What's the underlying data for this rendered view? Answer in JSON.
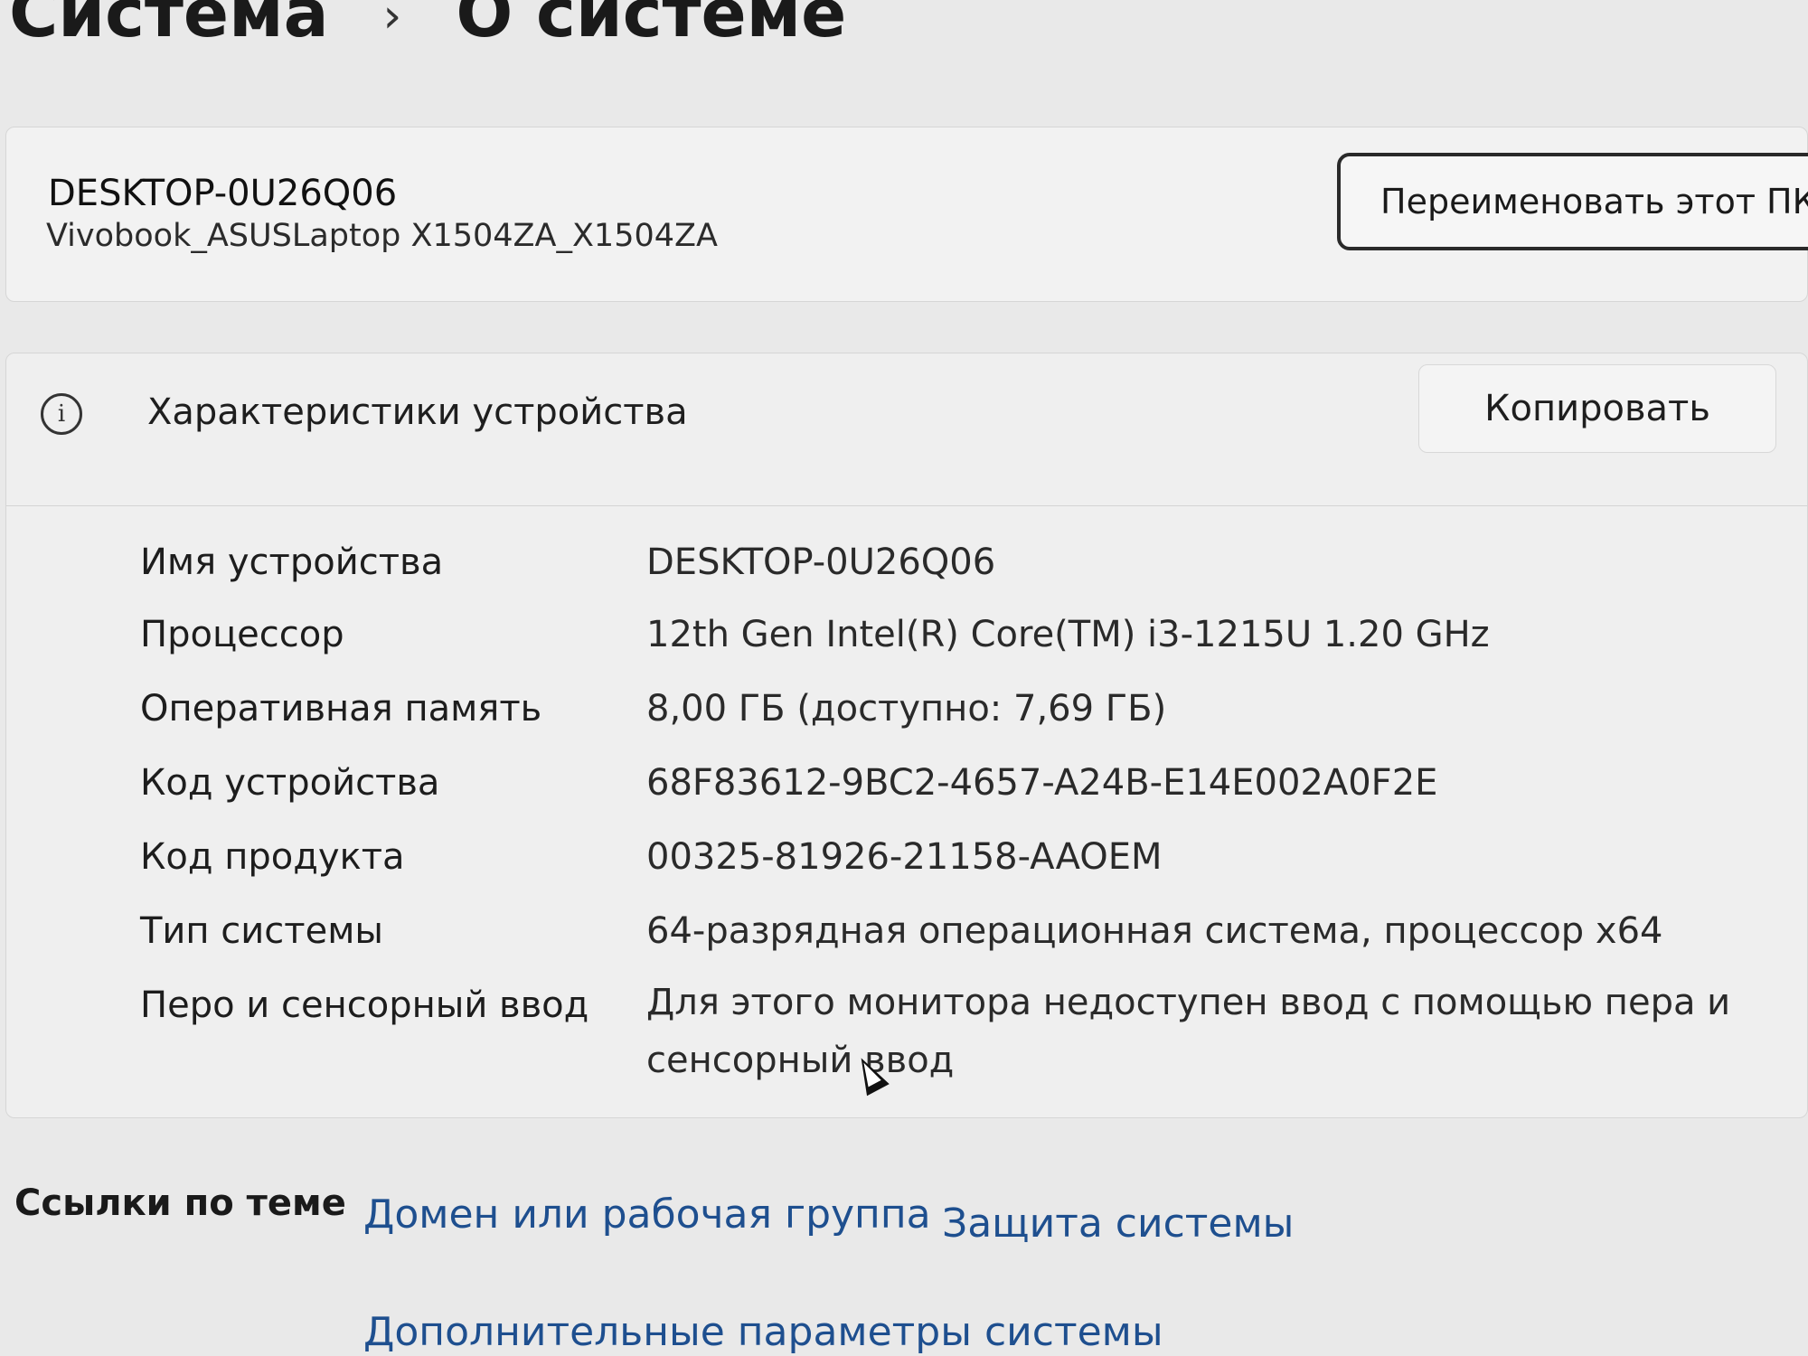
{
  "breadcrumb": {
    "root": "Система",
    "separator": "›",
    "current": "О системе"
  },
  "pc": {
    "name": "DESKTOP-0U26Q06",
    "model": "Vivobook_ASUSLaptop X1504ZA_X1504ZA",
    "rename_label": "Переименовать этот ПК"
  },
  "specs": {
    "icon": "info-icon",
    "title": "Характеристики устройства",
    "copy_label": "Копировать",
    "rows": [
      {
        "label": "Имя устройства",
        "value": "DESKTOP-0U26Q06"
      },
      {
        "label": "Процессор",
        "value": "12th Gen Intel(R) Core(TM) i3-1215U   1.20 GHz"
      },
      {
        "label": "Оперативная память",
        "value": "8,00 ГБ (доступно: 7,69 ГБ)"
      },
      {
        "label": "Код устройства",
        "value": "68F83612-9BC2-4657-A24B-E14E002A0F2E"
      },
      {
        "label": "Код продукта",
        "value": "00325-81926-21158-AAOEM"
      },
      {
        "label": "Тип системы",
        "value": "64-разрядная операционная система, процессор x64"
      },
      {
        "label": "Перо и сенсорный ввод",
        "value": "Для этого монитора недоступен ввод с помощью пера и сенсорный ввод"
      }
    ]
  },
  "related": {
    "label": "Ссылки по теме",
    "links": [
      "Домен или рабочая группа",
      "Защита системы",
      "Дополнительные параметры системы"
    ]
  }
}
